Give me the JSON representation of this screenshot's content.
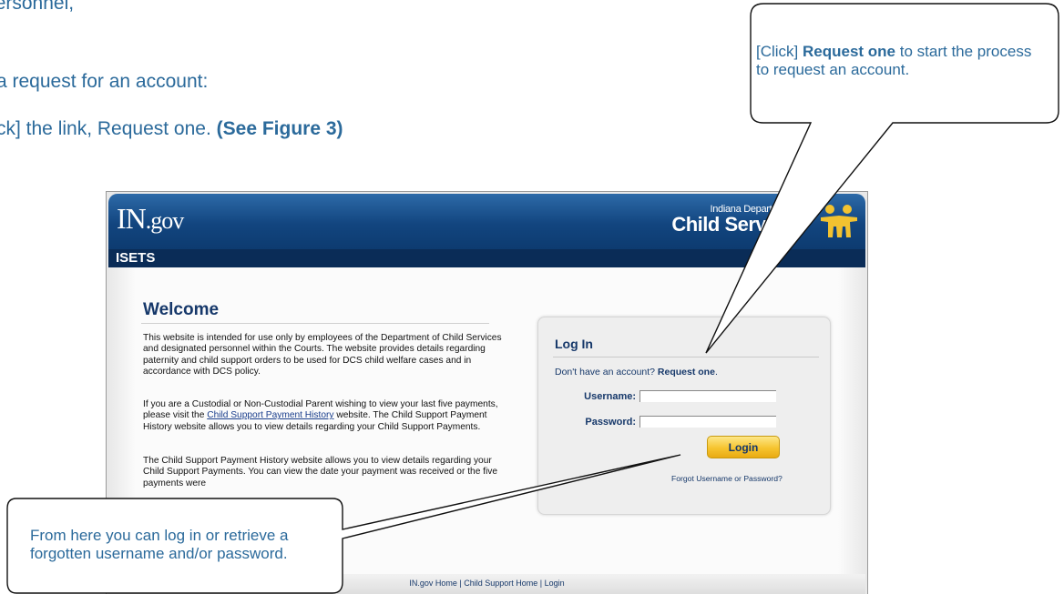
{
  "document": {
    "line_top": "by personnel, ",
    "line_request": "a request for an account:",
    "line_click_part1": "ck] the link, Request one. ",
    "line_click_part2": "(See Figure 3)"
  },
  "browser_page": {
    "banner": {
      "logo_main": "IN",
      "logo_suffix": ".gov",
      "agency_top": "Indiana Department of",
      "agency_main": "Child Services",
      "icon": "people-icon"
    },
    "app_title": "ISETS",
    "welcome": {
      "heading": "Welcome",
      "para_1": "This website is intended for use only by employees of the Department of Child Services and designated personnel within the Courts. The website provides details regarding paternity and child support orders to be used for DCS child welfare cases and in accordance with DCS policy.",
      "para_2_before_link": "If you are a Custodial or Non-Custodial Parent wishing to view your last five payments, please visit the ",
      "para_2_link": "Child Support Payment History",
      "para_2_after_link": " website. The Child Support Payment History website allows you to view details regarding your Child Support Payments.",
      "para_3": "The Child Support Payment History website allows you to view details regarding your Child Support Payments. You can view the date your payment was received or the five payments were"
    },
    "login": {
      "title": "Log In",
      "no_account_text": "Don't have an account? ",
      "request_link": "Request one",
      "request_link_suffix": ".",
      "username_label": "Username:",
      "username_value": "",
      "password_label": "Password:",
      "password_value": "",
      "login_button": "Login",
      "forgot_prefix": "Forgot ",
      "forgot_username": "Username",
      "forgot_or": " or ",
      "forgot_password": "Password?"
    },
    "footer": {
      "home": "IN.gov Home",
      "sep": " | ",
      "child_support_home": "Child Support Home",
      "login": "Login"
    }
  },
  "callouts": {
    "right_prefix": "[Click] ",
    "right_bold": "Request one",
    "right_suffix": " to start the process to request an account.",
    "left": "From here you can log in or retrieve a forgotten username and/or password."
  },
  "colors": {
    "doc_text": "#2b6a9b",
    "banner_blue": "#12457f",
    "appbar_navy": "#0a2c57",
    "login_button_gold": "#f6c42f"
  }
}
